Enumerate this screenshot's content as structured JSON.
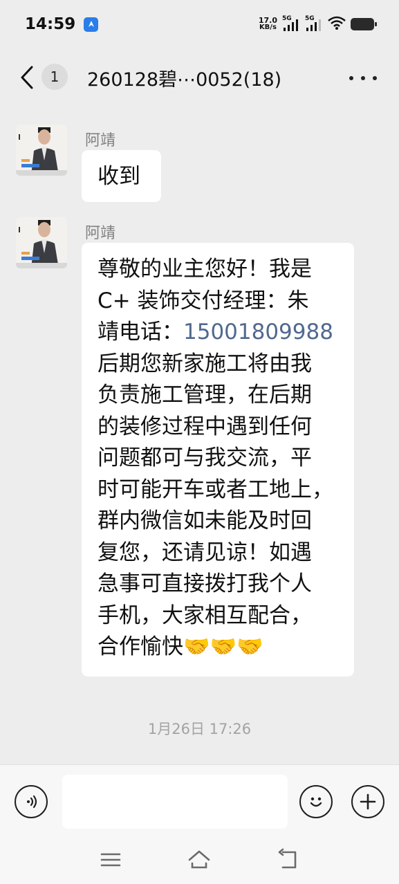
{
  "status_bar": {
    "time": "14:59",
    "net_speed_value": "17.0",
    "net_speed_unit": "KB/s",
    "signal1_label": "5G",
    "signal2_label": "5G"
  },
  "header": {
    "unread_count": "1",
    "title": "260128碧⋯0052(18)"
  },
  "messages": [
    {
      "sender": "阿靖",
      "text": "收到"
    },
    {
      "sender": "阿靖",
      "lines": [
        "尊敬的业主您好！我是",
        "C+ 装饰交付经理：朱",
        "靖电话：",
        "后期您新家施工将由我",
        "负责施工管理，在后期",
        "的装修过程中遇到任何",
        "问题都可与我交流，平",
        "时可能开车或者工地上，",
        "群内微信如未能及时回",
        "复您，还请见谅！如遇",
        "急事可直接拨打我个人",
        "手机，大家相互配合，",
        "合作愉快🤝🤝🤝"
      ],
      "phone": "15001809988"
    }
  ],
  "timestamp": "1月26日 17:26",
  "icons": {
    "voice": "voice-icon",
    "emoji": "emoji-icon",
    "add": "plus-icon",
    "back": "back-chevron-icon",
    "more": "more-dots-icon",
    "menu": "menu-icon",
    "home": "home-icon",
    "recent": "back-gesture-icon"
  }
}
